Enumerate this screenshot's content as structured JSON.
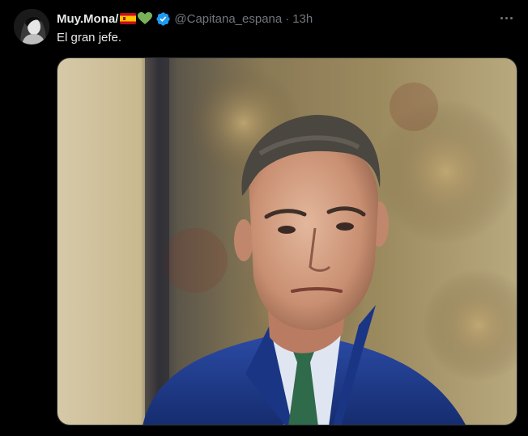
{
  "tweet": {
    "author": {
      "display_name": "Muy.Mona/",
      "emojis": [
        "spain-flag-icon",
        "green-heart-icon"
      ],
      "verified": true,
      "handle": "@Capitana_espana",
      "separator": "·",
      "timestamp": "13h"
    },
    "text": "El gran jefe.",
    "media": {
      "type": "photo",
      "alt_icon": "photo-of-man-in-suit"
    },
    "menu_icon": "more-options-icon"
  },
  "colors": {
    "background": "#000000",
    "text_primary": "#e7e9ea",
    "text_secondary": "#71767b",
    "verified_blue": "#1d9bf0",
    "suit": "#1f3b8a",
    "tie": "#2f6a4a"
  }
}
